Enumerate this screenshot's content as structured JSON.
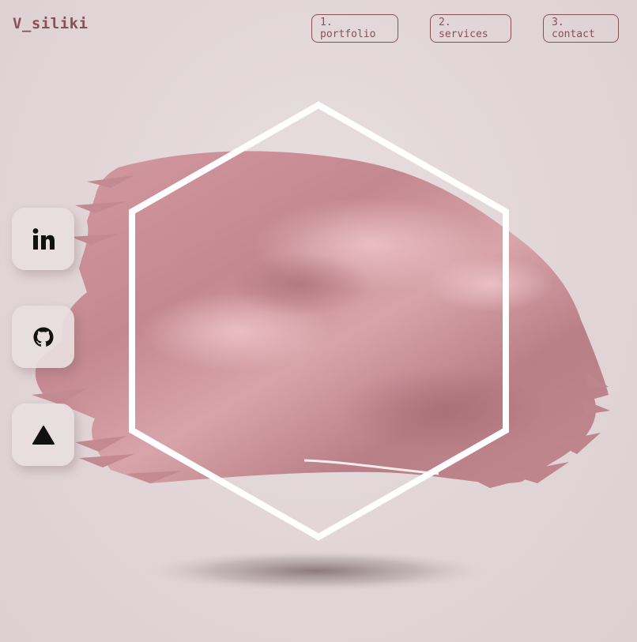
{
  "brand": {
    "logo_text": "V_siliki"
  },
  "nav": {
    "items": [
      {
        "label": "1. portfolio"
      },
      {
        "label": "2. services"
      },
      {
        "label": "3. contact"
      }
    ]
  },
  "social": {
    "items": [
      {
        "icon": "linkedin-icon"
      },
      {
        "icon": "github-icon"
      },
      {
        "icon": "triangle-icon"
      }
    ]
  },
  "colors": {
    "background": "#e2d6d8",
    "accent": "#8a4f57",
    "brush": "#c98d95",
    "hexagon": "#ffffff"
  }
}
